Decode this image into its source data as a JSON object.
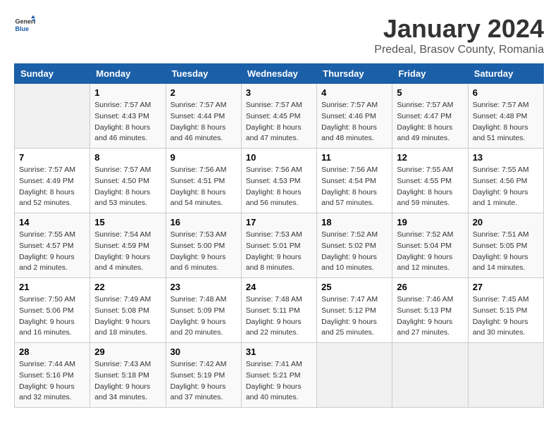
{
  "header": {
    "logo_general": "General",
    "logo_blue": "Blue",
    "title": "January 2024",
    "subtitle": "Predeal, Brasov County, Romania"
  },
  "weekdays": [
    "Sunday",
    "Monday",
    "Tuesday",
    "Wednesday",
    "Thursday",
    "Friday",
    "Saturday"
  ],
  "weeks": [
    [
      {
        "day": "",
        "sunrise": "",
        "sunset": "",
        "daylight": ""
      },
      {
        "day": "1",
        "sunrise": "Sunrise: 7:57 AM",
        "sunset": "Sunset: 4:43 PM",
        "daylight": "Daylight: 8 hours and 46 minutes."
      },
      {
        "day": "2",
        "sunrise": "Sunrise: 7:57 AM",
        "sunset": "Sunset: 4:44 PM",
        "daylight": "Daylight: 8 hours and 46 minutes."
      },
      {
        "day": "3",
        "sunrise": "Sunrise: 7:57 AM",
        "sunset": "Sunset: 4:45 PM",
        "daylight": "Daylight: 8 hours and 47 minutes."
      },
      {
        "day": "4",
        "sunrise": "Sunrise: 7:57 AM",
        "sunset": "Sunset: 4:46 PM",
        "daylight": "Daylight: 8 hours and 48 minutes."
      },
      {
        "day": "5",
        "sunrise": "Sunrise: 7:57 AM",
        "sunset": "Sunset: 4:47 PM",
        "daylight": "Daylight: 8 hours and 49 minutes."
      },
      {
        "day": "6",
        "sunrise": "Sunrise: 7:57 AM",
        "sunset": "Sunset: 4:48 PM",
        "daylight": "Daylight: 8 hours and 51 minutes."
      }
    ],
    [
      {
        "day": "7",
        "sunrise": "Sunrise: 7:57 AM",
        "sunset": "Sunset: 4:49 PM",
        "daylight": "Daylight: 8 hours and 52 minutes."
      },
      {
        "day": "8",
        "sunrise": "Sunrise: 7:57 AM",
        "sunset": "Sunset: 4:50 PM",
        "daylight": "Daylight: 8 hours and 53 minutes."
      },
      {
        "day": "9",
        "sunrise": "Sunrise: 7:56 AM",
        "sunset": "Sunset: 4:51 PM",
        "daylight": "Daylight: 8 hours and 54 minutes."
      },
      {
        "day": "10",
        "sunrise": "Sunrise: 7:56 AM",
        "sunset": "Sunset: 4:53 PM",
        "daylight": "Daylight: 8 hours and 56 minutes."
      },
      {
        "day": "11",
        "sunrise": "Sunrise: 7:56 AM",
        "sunset": "Sunset: 4:54 PM",
        "daylight": "Daylight: 8 hours and 57 minutes."
      },
      {
        "day": "12",
        "sunrise": "Sunrise: 7:55 AM",
        "sunset": "Sunset: 4:55 PM",
        "daylight": "Daylight: 8 hours and 59 minutes."
      },
      {
        "day": "13",
        "sunrise": "Sunrise: 7:55 AM",
        "sunset": "Sunset: 4:56 PM",
        "daylight": "Daylight: 9 hours and 1 minute."
      }
    ],
    [
      {
        "day": "14",
        "sunrise": "Sunrise: 7:55 AM",
        "sunset": "Sunset: 4:57 PM",
        "daylight": "Daylight: 9 hours and 2 minutes."
      },
      {
        "day": "15",
        "sunrise": "Sunrise: 7:54 AM",
        "sunset": "Sunset: 4:59 PM",
        "daylight": "Daylight: 9 hours and 4 minutes."
      },
      {
        "day": "16",
        "sunrise": "Sunrise: 7:53 AM",
        "sunset": "Sunset: 5:00 PM",
        "daylight": "Daylight: 9 hours and 6 minutes."
      },
      {
        "day": "17",
        "sunrise": "Sunrise: 7:53 AM",
        "sunset": "Sunset: 5:01 PM",
        "daylight": "Daylight: 9 hours and 8 minutes."
      },
      {
        "day": "18",
        "sunrise": "Sunrise: 7:52 AM",
        "sunset": "Sunset: 5:02 PM",
        "daylight": "Daylight: 9 hours and 10 minutes."
      },
      {
        "day": "19",
        "sunrise": "Sunrise: 7:52 AM",
        "sunset": "Sunset: 5:04 PM",
        "daylight": "Daylight: 9 hours and 12 minutes."
      },
      {
        "day": "20",
        "sunrise": "Sunrise: 7:51 AM",
        "sunset": "Sunset: 5:05 PM",
        "daylight": "Daylight: 9 hours and 14 minutes."
      }
    ],
    [
      {
        "day": "21",
        "sunrise": "Sunrise: 7:50 AM",
        "sunset": "Sunset: 5:06 PM",
        "daylight": "Daylight: 9 hours and 16 minutes."
      },
      {
        "day": "22",
        "sunrise": "Sunrise: 7:49 AM",
        "sunset": "Sunset: 5:08 PM",
        "daylight": "Daylight: 9 hours and 18 minutes."
      },
      {
        "day": "23",
        "sunrise": "Sunrise: 7:48 AM",
        "sunset": "Sunset: 5:09 PM",
        "daylight": "Daylight: 9 hours and 20 minutes."
      },
      {
        "day": "24",
        "sunrise": "Sunrise: 7:48 AM",
        "sunset": "Sunset: 5:11 PM",
        "daylight": "Daylight: 9 hours and 22 minutes."
      },
      {
        "day": "25",
        "sunrise": "Sunrise: 7:47 AM",
        "sunset": "Sunset: 5:12 PM",
        "daylight": "Daylight: 9 hours and 25 minutes."
      },
      {
        "day": "26",
        "sunrise": "Sunrise: 7:46 AM",
        "sunset": "Sunset: 5:13 PM",
        "daylight": "Daylight: 9 hours and 27 minutes."
      },
      {
        "day": "27",
        "sunrise": "Sunrise: 7:45 AM",
        "sunset": "Sunset: 5:15 PM",
        "daylight": "Daylight: 9 hours and 30 minutes."
      }
    ],
    [
      {
        "day": "28",
        "sunrise": "Sunrise: 7:44 AM",
        "sunset": "Sunset: 5:16 PM",
        "daylight": "Daylight: 9 hours and 32 minutes."
      },
      {
        "day": "29",
        "sunrise": "Sunrise: 7:43 AM",
        "sunset": "Sunset: 5:18 PM",
        "daylight": "Daylight: 9 hours and 34 minutes."
      },
      {
        "day": "30",
        "sunrise": "Sunrise: 7:42 AM",
        "sunset": "Sunset: 5:19 PM",
        "daylight": "Daylight: 9 hours and 37 minutes."
      },
      {
        "day": "31",
        "sunrise": "Sunrise: 7:41 AM",
        "sunset": "Sunset: 5:21 PM",
        "daylight": "Daylight: 9 hours and 40 minutes."
      },
      {
        "day": "",
        "sunrise": "",
        "sunset": "",
        "daylight": ""
      },
      {
        "day": "",
        "sunrise": "",
        "sunset": "",
        "daylight": ""
      },
      {
        "day": "",
        "sunrise": "",
        "sunset": "",
        "daylight": ""
      }
    ]
  ]
}
